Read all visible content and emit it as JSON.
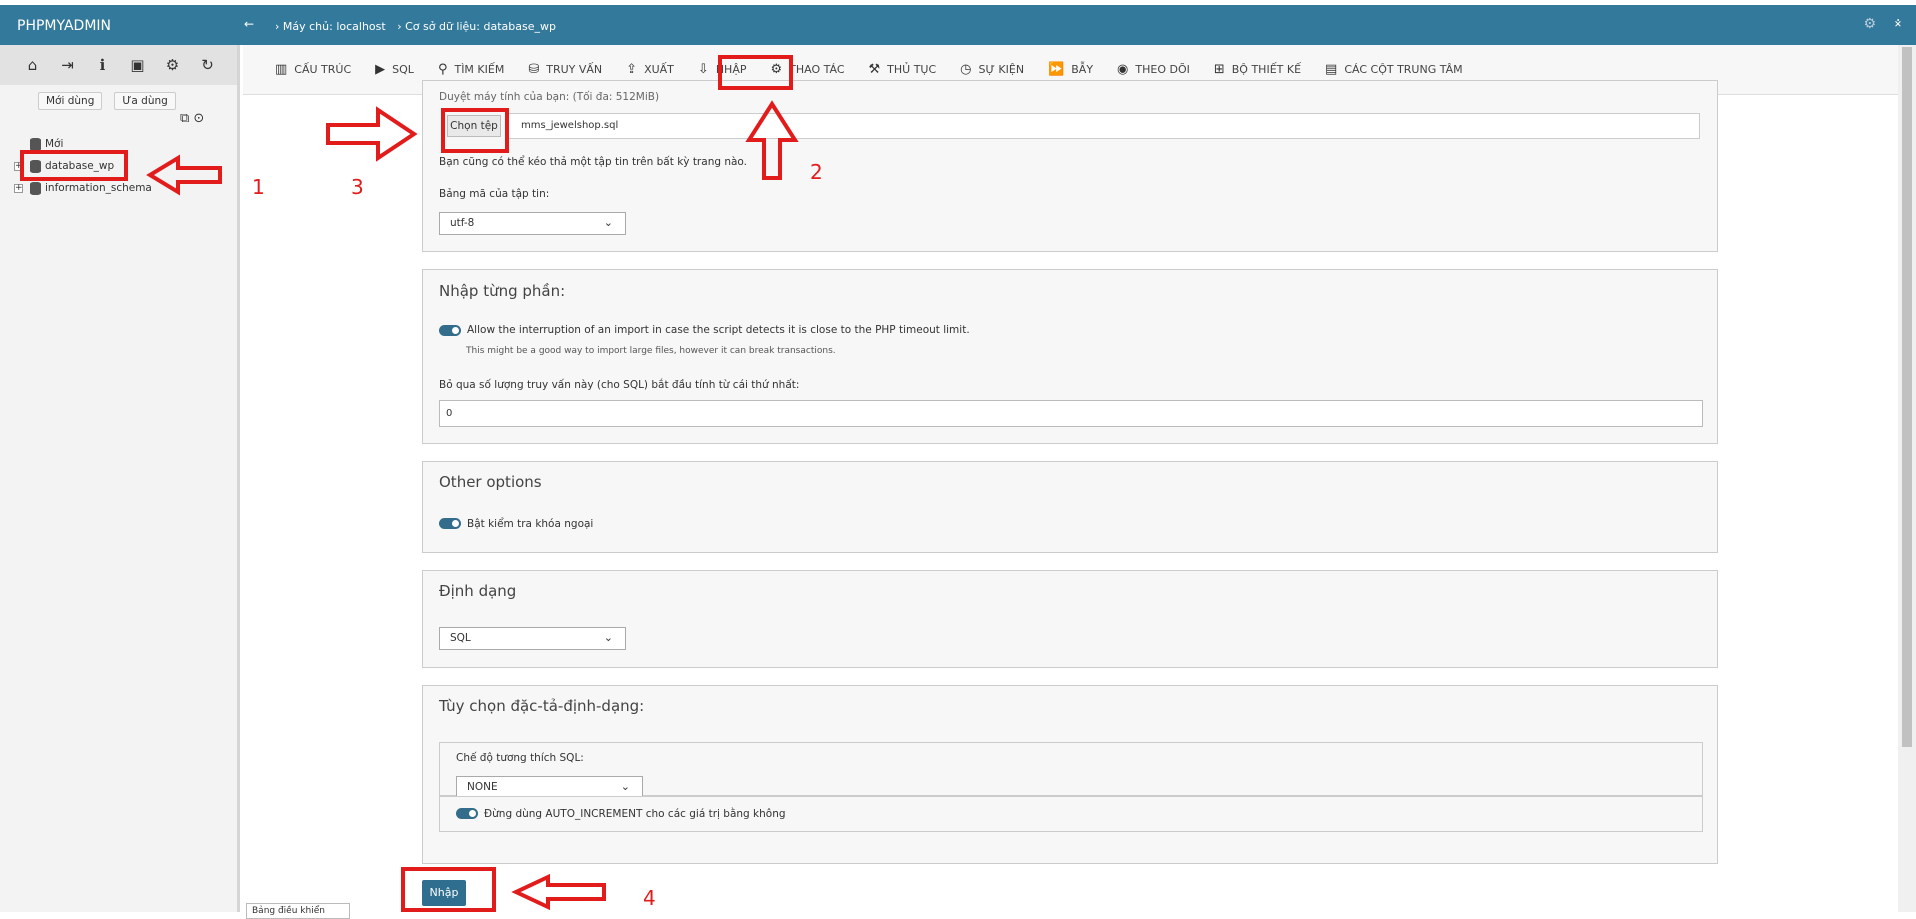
{
  "topbar": {
    "brand": "PHPMYADMIN",
    "back_icon": "←",
    "breadcrumb_server": "› Máy chủ: localhost",
    "breadcrumb_db": "› Cơ sở dữ liệu: database_wp",
    "settings_icon": "⚙",
    "collapse_icon": "⨰"
  },
  "sidebar": {
    "icons": [
      "⌂",
      "⇥",
      "ℹ",
      "▣",
      "⚙",
      "↻"
    ],
    "recent_label": "Mới dùng",
    "favorite_label": "Ưa dùng",
    "mini_icons": "⧉ ⊙",
    "tree": [
      {
        "label": "Mới",
        "expandable": false
      },
      {
        "label": "database_wp",
        "expandable": true
      },
      {
        "label": "information_schema",
        "expandable": true
      }
    ]
  },
  "tabs": [
    {
      "icon": "▥",
      "label": "CẤU TRÚC"
    },
    {
      "icon": "▶",
      "label": "SQL"
    },
    {
      "icon": "⚲",
      "label": "TÌM KIẾM"
    },
    {
      "icon": "⛁",
      "label": "TRUY VẤN"
    },
    {
      "icon": "⇪",
      "label": "XUẤT"
    },
    {
      "icon": "⇩",
      "label": "NHẬP"
    },
    {
      "icon": "⚙",
      "label": "THAO TÁC"
    },
    {
      "icon": "⚒",
      "label": "THỦ TỤC"
    },
    {
      "icon": "◷",
      "label": "SỰ KIỆN"
    },
    {
      "icon": "⏩",
      "label": "BẪY"
    },
    {
      "icon": "◉",
      "label": "THEO DÕI"
    },
    {
      "icon": "⊞",
      "label": "BỘ THIẾT KẾ"
    },
    {
      "icon": "▤",
      "label": "CÁC CỘT TRUNG TÂM"
    }
  ],
  "upload": {
    "browse_label": "Duyệt máy tính của bạn: (Tối đa: 512MiB)",
    "choose_file": "Chọn tệp",
    "file_name": "mms_jewelshop.sql",
    "drag_note": "Bạn cũng có thể kéo thả một tập tin trên bất kỳ trang nào.",
    "charset_label": "Bảng mã của tập tin:",
    "charset_value": "utf-8"
  },
  "partial": {
    "title": "Nhập từng phần:",
    "allow_interrupt": "Allow the interruption of an import in case the script detects it is close to the PHP timeout limit.",
    "interrupt_note": "This might be a good way to import large files, however it can break transactions.",
    "skip_label": "Bỏ qua số lượng truy vấn này (cho SQL) bắt đầu tính từ cái thứ nhất:",
    "skip_value": "0"
  },
  "other": {
    "title": "Other options",
    "fk_check": "Bật kiểm tra khóa ngoại"
  },
  "format": {
    "title": "Định dạng",
    "value": "SQL"
  },
  "format_options": {
    "title": "Tùy chọn đặc-tả-định-dạng:",
    "compat_label": "Chế độ tương thích SQL:",
    "compat_value": "NONE",
    "auto_increment": "Đừng dùng AUTO_INCREMENT cho các giá trị bằng không"
  },
  "submit_label": "Nhập",
  "console_label": "Bảng điều khiển",
  "annotations": {
    "n1": "1",
    "n2": "2",
    "n3": "3",
    "n4": "4"
  },
  "colors": {
    "header": "#33799b",
    "button": "#2f6e8e",
    "annotation": "#e21b1b"
  }
}
